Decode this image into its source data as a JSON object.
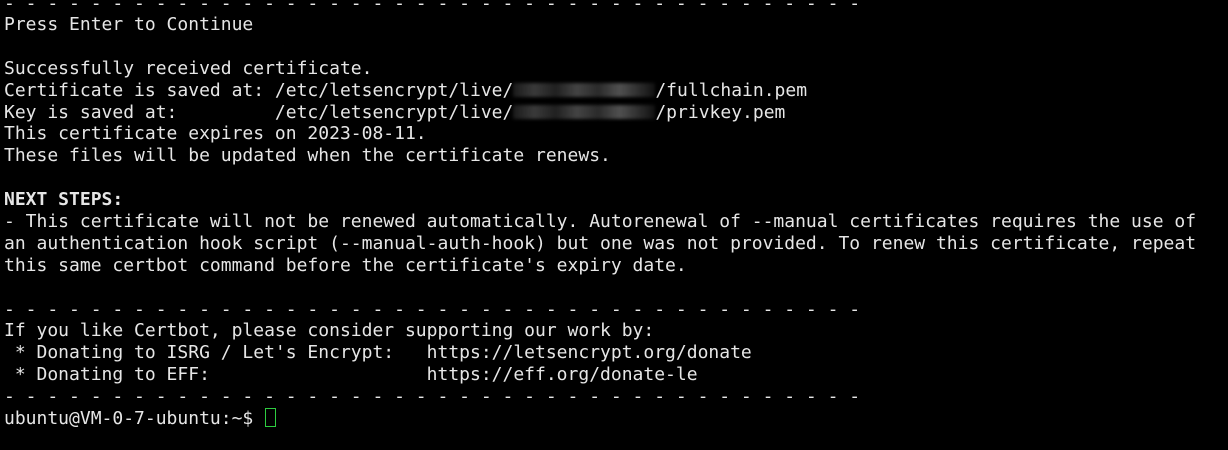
{
  "terminal": {
    "separator": "- - - - - - - - - - - - - - - - - - - - - - - - - - - - - - - - - - - - - - - -",
    "press_enter": "Press Enter to Continue",
    "success": "Successfully received certificate.",
    "cert_prefix": "Certificate is saved at: /etc/letsencrypt/live/",
    "cert_suffix": "/fullchain.pem",
    "key_prefix": "Key is saved at:         /etc/letsencrypt/live/",
    "key_suffix": "/privkey.pem",
    "expires": "This certificate expires on 2023-08-11.",
    "updated": "These files will be updated when the certificate renews.",
    "next_steps": "NEXT STEPS:",
    "next_1": "- This certificate will not be renewed automatically. Autorenewal of --manual certificates requires the use of",
    "next_2": "an authentication hook script (--manual-auth-hook) but one was not provided. To renew this certificate, repeat",
    "next_3": "this same certbot command before the certificate's expiry date.",
    "support": "If you like Certbot, please consider supporting our work by:",
    "donate_isrg": " * Donating to ISRG / Let's Encrypt:   https://letsencrypt.org/donate",
    "donate_eff": " * Donating to EFF:                    https://eff.org/donate-le",
    "prompt": "ubuntu@VM-0-7-ubuntu:~$ ",
    "cursor_color": "#2ecc40"
  }
}
